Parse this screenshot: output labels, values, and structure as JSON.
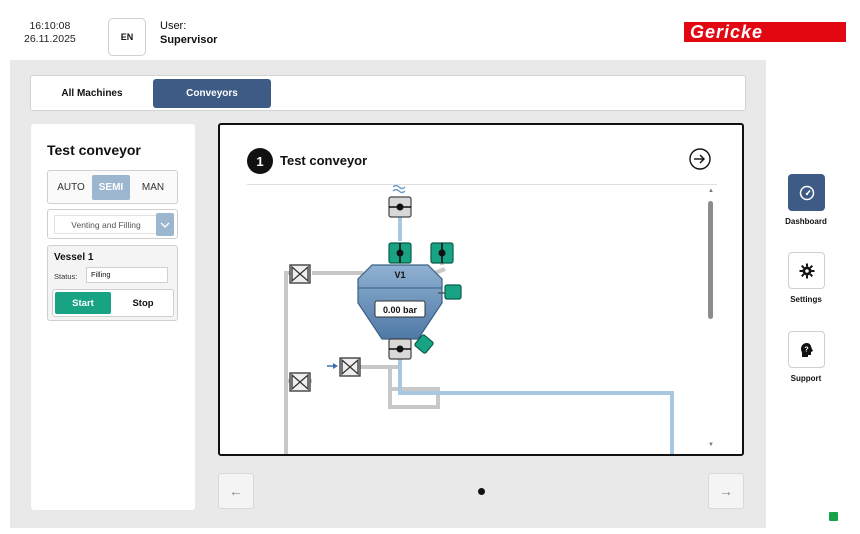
{
  "header": {
    "time": "16:10:08",
    "date": "26.11.2025",
    "lang": "EN",
    "user_label": "User:",
    "user_role": "Supervisor",
    "logo_text": "Gericke",
    "brand_color": "#e30613"
  },
  "tabs": [
    {
      "label": "All Machines",
      "active": false
    },
    {
      "label": "Conveyors",
      "active": true
    }
  ],
  "left_panel": {
    "title": "Test conveyor",
    "modes": [
      "AUTO",
      "SEMI",
      "MAN"
    ],
    "active_mode": "SEMI",
    "sequence_select": "Venting and Filling",
    "vessel": {
      "title": "Vessel 1",
      "status_label": "Status:",
      "status_value": "Filling",
      "start_label": "Start",
      "stop_label": "Stop"
    }
  },
  "card": {
    "number": "1",
    "title": "Test conveyor",
    "vessel_label": "V1",
    "pressure": "0.00 bar"
  },
  "pagination": {
    "prev": "←",
    "next": "→"
  },
  "right_rail": {
    "dashboard": "Dashboard",
    "settings": "Settings",
    "support": "Support"
  },
  "colors": {
    "accent": "#3d5b85",
    "start_green": "#17a384",
    "pipe_blue": "#a8c8e2",
    "pipe_gray": "#c8c8c8"
  }
}
